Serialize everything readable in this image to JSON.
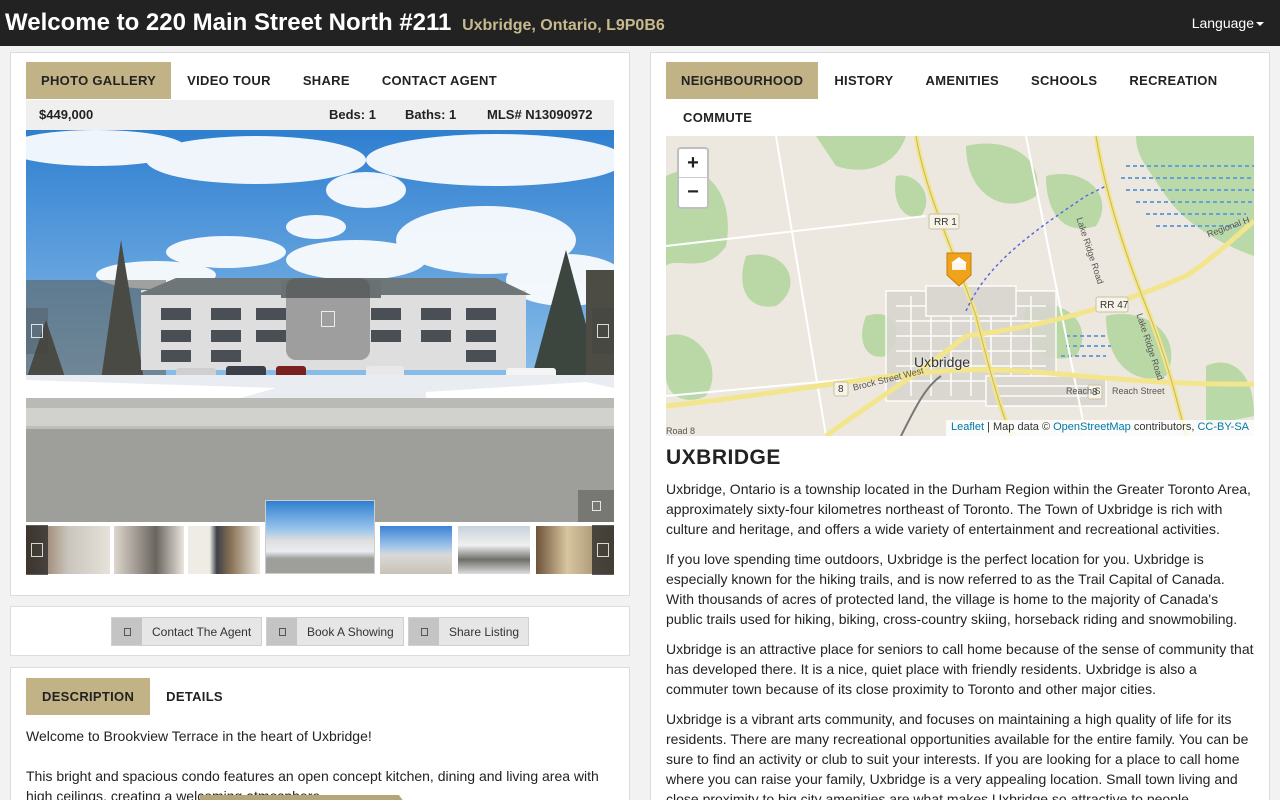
{
  "header": {
    "title": "Welcome to 220 Main Street North #211",
    "subtitle": "Uxbridge, Ontario, L9P0B6",
    "language_label": "Language"
  },
  "media_tabs": [
    "PHOTO GALLERY",
    "VIDEO TOUR",
    "SHARE",
    "CONTACT AGENT"
  ],
  "listing": {
    "price": "$449,000",
    "beds": "Beds: 1",
    "baths": "Baths: 1",
    "mls": "MLS# N13090972"
  },
  "actions": [
    "Contact The Agent",
    "Book A Showing",
    "Share Listing"
  ],
  "description_tabs": [
    "DESCRIPTION",
    "DETAILS"
  ],
  "description": {
    "p1": "Welcome to Brookview Terrace in the heart of Uxbridge!",
    "p2": "This bright and spacious condo features an open concept kitchen, dining and living area with high ceilings, creating a welcoming atmosphere."
  },
  "neighbourhood_tabs": [
    "NEIGHBOURHOOD",
    "HISTORY",
    "AMENITIES",
    "SCHOOLS",
    "RECREATION",
    "COMMUTE"
  ],
  "map": {
    "zoom_in": "+",
    "zoom_out": "−",
    "labels": {
      "town": "Uxbridge",
      "rr1": "RR 1",
      "rr47": "RR 47",
      "rr8a": "8",
      "rr8b": "8",
      "brock": "Brock Street West",
      "reach": "Reach S",
      "reach_street": "Reach Street",
      "lake_ridge_1": "Lake Ridge Road",
      "lake_ridge_2": "Lake Ridge Road",
      "regional": "Regional H",
      "road8": "Road 8"
    },
    "attribution": {
      "leaflet": "Leaflet",
      "map_data": "| Map data ©",
      "osm": "OpenStreetMap",
      "contributors": "contributors,",
      "license": "CC-BY-SA"
    }
  },
  "neighbourhood": {
    "city": "UXBRIDGE",
    "paragraphs": [
      "Uxbridge, Ontario is a township located in the Durham Region within the Greater Toronto Area, approximately sixty-four kilometres northeast of Toronto. The Town of Uxbridge is rich with culture and heritage, and offers a wide variety of entertainment and recreational activities.",
      "If you love spending time outdoors, Uxbridge is the perfect location for you. Uxbridge is especially known for the hiking trails, and is now referred to as the Trail Capital of Canada. With thousands of acres of protected land, the village is home to the majority of Canada's public trails used for hiking, biking, cross-country skiing, horseback riding and snowmobiling.",
      "Uxbridge is an attractive place for seniors to call home because of the sense of community that has developed there. It is a nice, quiet place with friendly residents. Uxbridge is also a commuter town because of its close proximity to Toronto and other major cities.",
      "Uxbridge is a vibrant arts community, and focuses on maintaining a high quality of life for its residents. There are many recreational opportunities available for the entire family. You can be sure to find an activity or club to suit your interests. If you are looking for a place to call home where you can raise your family, Uxbridge is a very appealing location. Small town living and close proximity to big city amenities are what makes Uxbridge so attractive to people."
    ]
  },
  "colors": {
    "accent_tab": "#c2b386",
    "subtitle": "#c8b98e",
    "topbar": "#222222",
    "map_marker": "#f0a21b"
  },
  "icons": {
    "marker": "home-marker-icon",
    "play": "play-icon",
    "fullscreen": "fullscreen-icon",
    "prev": "chevron-left-icon",
    "next": "chevron-right-icon"
  }
}
